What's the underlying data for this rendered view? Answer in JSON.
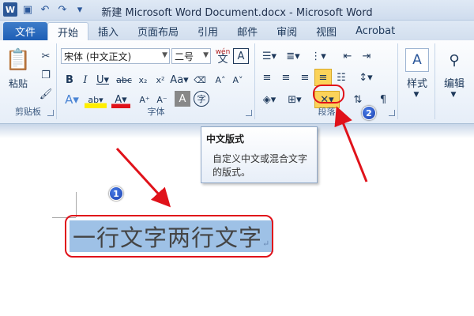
{
  "window": {
    "title": "新建 Microsoft Word Document.docx - Microsoft Word",
    "app_icon": "W"
  },
  "tabs": [
    {
      "label": "文件"
    },
    {
      "label": "开始"
    },
    {
      "label": "插入"
    },
    {
      "label": "页面布局"
    },
    {
      "label": "引用"
    },
    {
      "label": "邮件"
    },
    {
      "label": "审阅"
    },
    {
      "label": "视图"
    },
    {
      "label": "Acrobat"
    }
  ],
  "clipboard": {
    "paste_label": "粘贴",
    "group_label": "剪贴板"
  },
  "font": {
    "name": "宋体 (中文正文)",
    "size": "二号",
    "group_label": "字体",
    "wen": "wén",
    "char": "文",
    "A_border": "A"
  },
  "paragraph": {
    "group_label": "段落"
  },
  "styles": {
    "label": "样式"
  },
  "editing": {
    "label": "编辑"
  },
  "tooltip": {
    "title": "中文版式",
    "description": "自定义中文或混合文字的版式。"
  },
  "document": {
    "selected_text": "一行文字两行文字",
    "para_mark": "↵"
  },
  "annotations": {
    "badge1": "1",
    "badge2": "2",
    "color": "#e0121a"
  }
}
